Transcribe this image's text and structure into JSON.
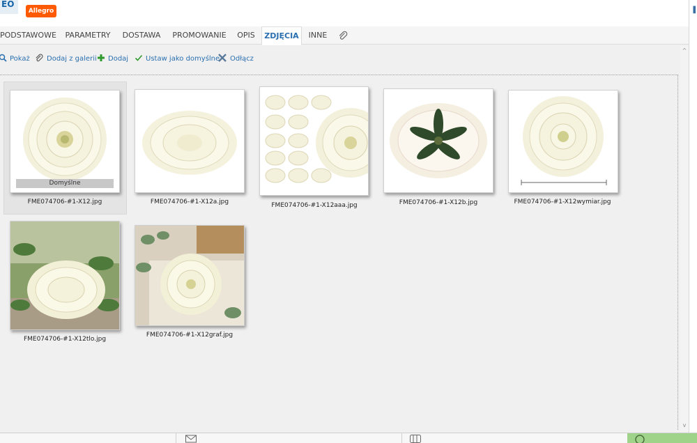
{
  "header": {
    "logo_text": "EO",
    "badge": "Allegro"
  },
  "tabs": [
    {
      "label": "PODSTAWOWE"
    },
    {
      "label": "PARAMETRY"
    },
    {
      "label": "DOSTAWA"
    },
    {
      "label": "PROMOWANIE"
    },
    {
      "label": "OPIS"
    },
    {
      "label": "ZDJĘCIA",
      "active": true
    },
    {
      "label": "INNE"
    }
  ],
  "toolbar": {
    "show_label": "Pokaż",
    "add_gallery_label": "Dodaj z galerii",
    "add_label": "Dodaj",
    "set_default_label": "Ustaw jako domyślne",
    "detach_label": "Odłącz"
  },
  "gallery": {
    "default_label": "Domyślne",
    "images": [
      {
        "filename": "FME074706-#1-X12.jpg",
        "default": true
      },
      {
        "filename": "FME074706-#1-X12a.jpg"
      },
      {
        "filename": "FME074706-#1-X12aaa.jpg"
      },
      {
        "filename": "FME074706-#1-X12b.jpg"
      },
      {
        "filename": "FME074706-#1-X12wymiar.jpg"
      },
      {
        "filename": "FME074706-#1-X12tlo.jpg"
      },
      {
        "filename": "FME074706-#1-X12graf.jpg"
      }
    ]
  },
  "colors": {
    "accent": "#2a6fb0",
    "badge": "#ff5a00",
    "status_green": "#9fd38a"
  }
}
